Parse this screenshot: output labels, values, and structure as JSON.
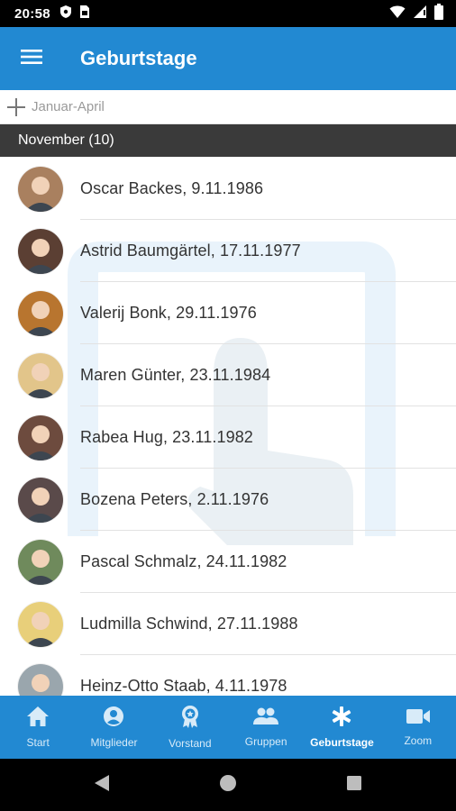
{
  "status_bar": {
    "time": "20:58"
  },
  "app_bar": {
    "title": "Geburtstage"
  },
  "range_toggle": {
    "label": "Januar-April"
  },
  "month_header": {
    "label": "November (10)"
  },
  "birthdays": [
    {
      "text": "Oscar Backes, 9.11.1986",
      "avatar_color": "#a9805f"
    },
    {
      "text": "Astrid Baumgärtel, 17.11.1977",
      "avatar_color": "#5b3f33"
    },
    {
      "text": "Valerij Bonk, 29.11.1976",
      "avatar_color": "#b8752f"
    },
    {
      "text": "Maren Günter, 23.11.1984",
      "avatar_color": "#e2c58a"
    },
    {
      "text": "Rabea Hug, 23.11.1982",
      "avatar_color": "#6d4b3e"
    },
    {
      "text": "Bozena Peters, 2.11.1976",
      "avatar_color": "#5a4a4a"
    },
    {
      "text": "Pascal Schmalz, 24.11.1982",
      "avatar_color": "#6f8a5c"
    },
    {
      "text": "Ludmilla Schwind, 27.11.1988",
      "avatar_color": "#e8cf7a"
    },
    {
      "text": "Heinz-Otto Staab, 4.11.1978",
      "avatar_color": "#9aa6ad"
    }
  ],
  "bottom_nav": [
    {
      "label": "Start",
      "icon": "home-icon"
    },
    {
      "label": "Mitglieder",
      "icon": "person-icon"
    },
    {
      "label": "Vorstand",
      "icon": "award-icon"
    },
    {
      "label": "Gruppen",
      "icon": "group-icon"
    },
    {
      "label": "Geburtstage",
      "icon": "asterisk-icon",
      "active": true
    },
    {
      "label": "Zoom",
      "icon": "video-icon"
    }
  ],
  "colors": {
    "primary": "#2289d2",
    "month_header_bg": "#3a3a3a",
    "status_bar_bg": "#000000"
  }
}
